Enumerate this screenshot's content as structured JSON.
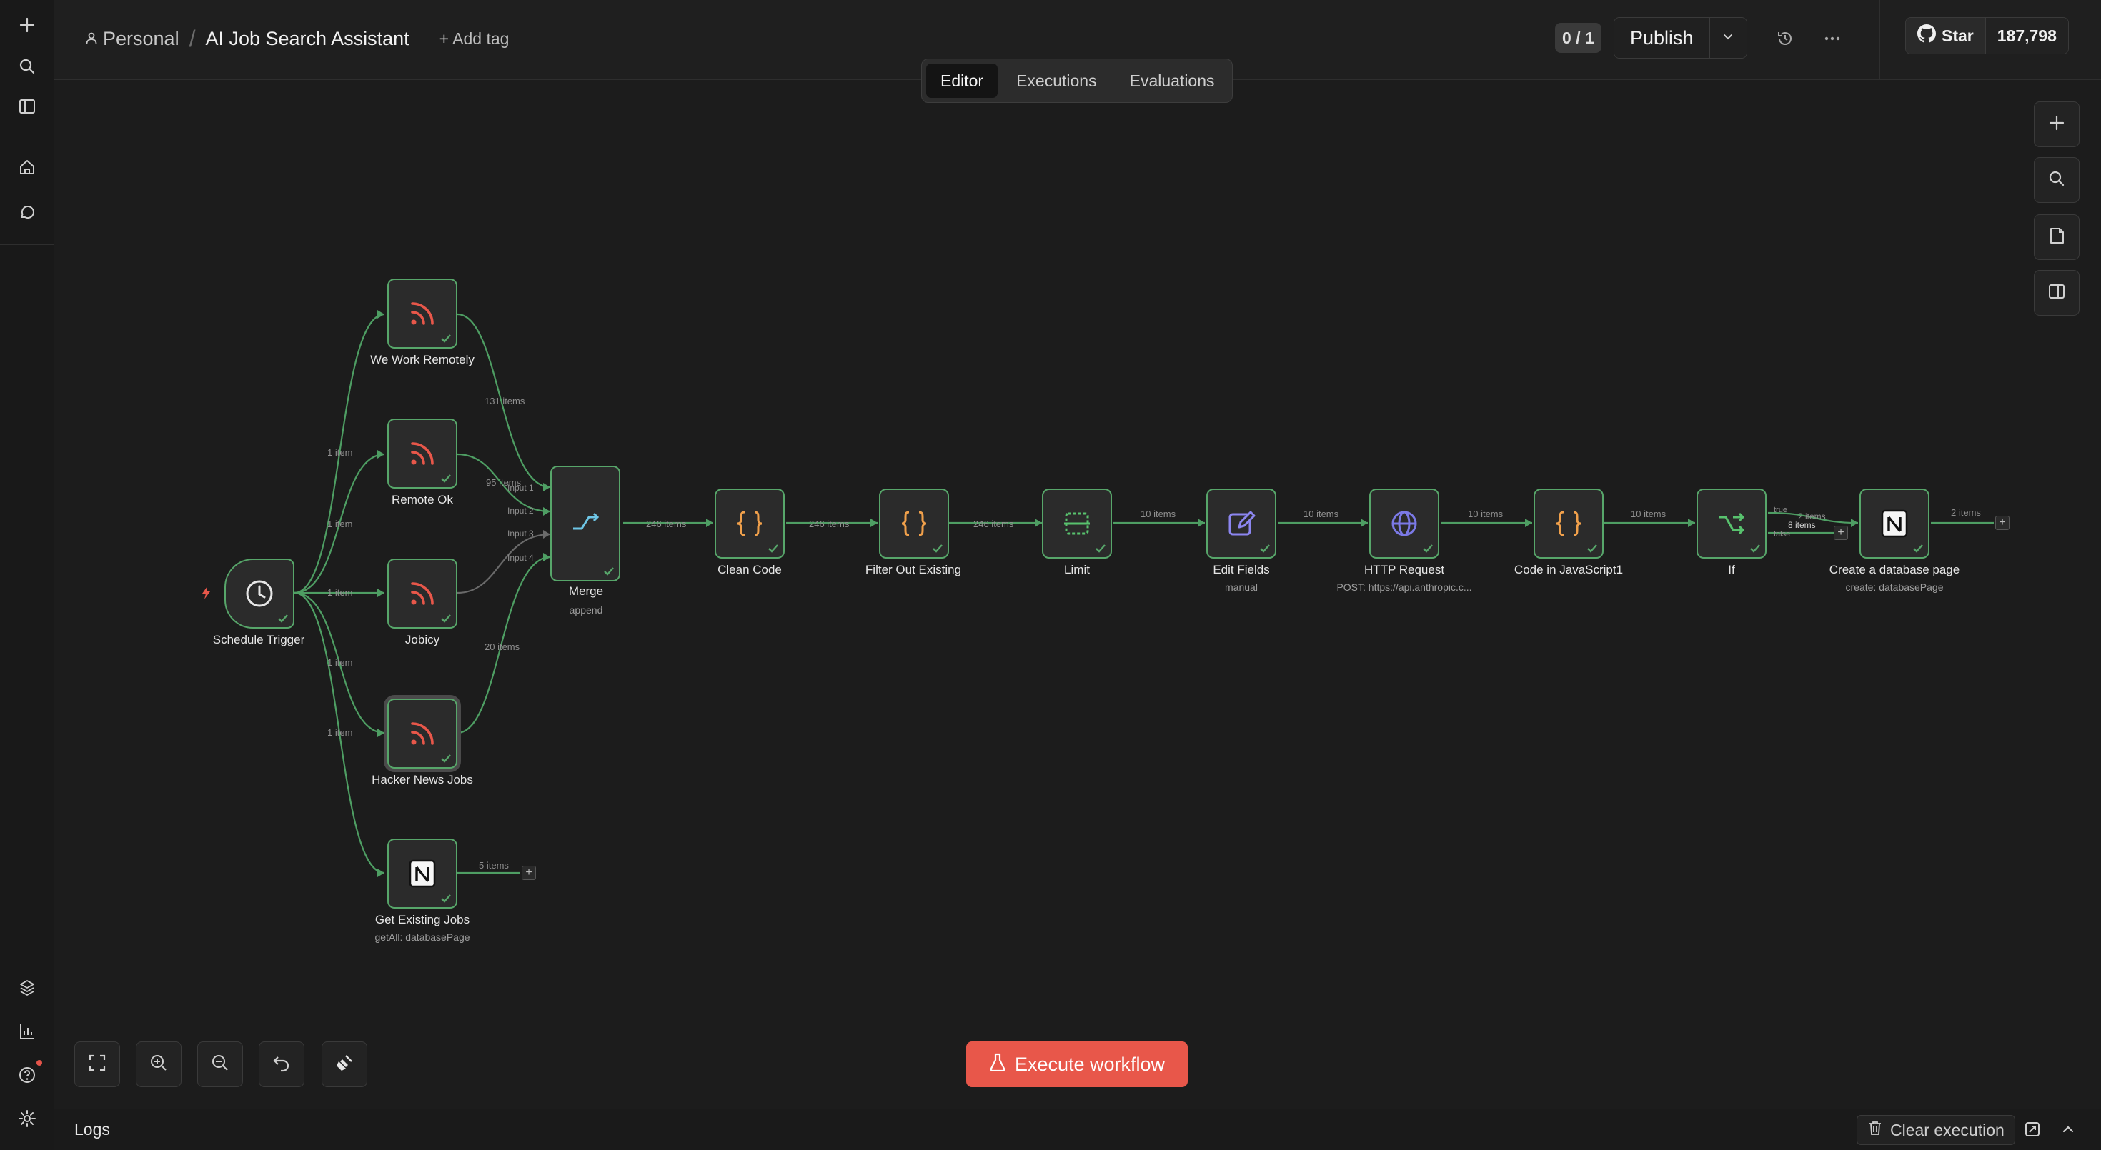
{
  "breadcrumb": {
    "owner": "Personal",
    "separator": "/",
    "title": "AI Job Search Assistant",
    "add_tag": "+ Add tag"
  },
  "header": {
    "counter": "0 / 1",
    "publish_label": "Publish"
  },
  "github": {
    "star_label": "Star",
    "star_count": "187,798"
  },
  "tabs": [
    {
      "label": "Editor",
      "active": true
    },
    {
      "label": "Executions"
    },
    {
      "label": "Evaluations"
    }
  ],
  "nodes": {
    "schedule": {
      "label": "Schedule Trigger"
    },
    "wwr": {
      "label": "We Work Remotely"
    },
    "remoteok": {
      "label": "Remote Ok"
    },
    "jobicy": {
      "label": "Jobicy"
    },
    "hn": {
      "label": "Hacker News Jobs"
    },
    "notion_get": {
      "label": "Get Existing Jobs",
      "sub": "getAll: databasePage"
    },
    "merge": {
      "label": "Merge",
      "sub": "append"
    },
    "clean": {
      "label": "Clean Code"
    },
    "filter": {
      "label": "Filter Out Existing"
    },
    "limit": {
      "label": "Limit"
    },
    "edit": {
      "label": "Edit Fields",
      "sub": "manual"
    },
    "http": {
      "label": "HTTP Request",
      "sub": "POST: https://api.anthropic.c..."
    },
    "code": {
      "label": "Code in JavaScript1"
    },
    "if": {
      "label": "If"
    },
    "notion_create": {
      "label": "Create a database page",
      "sub": "create: databasePage"
    }
  },
  "edges": {
    "e1": "1 item",
    "e2": "1 item",
    "e3": "1 item",
    "e4": "1 item",
    "e5": "1 item",
    "wwr_out": "131 items",
    "remoteok_out": "95 items",
    "hn_out": "20 items",
    "merge_in": [
      "Input 1",
      "Input 2",
      "Input 3",
      "Input 4"
    ],
    "get_out": "5 items",
    "merge_out": "246 items",
    "clean_out": "246 items",
    "filter_out": "246 items",
    "limit_out": "10 items",
    "edit_out": "10 items",
    "http_out": "10 items",
    "code_out": "10 items",
    "if_true": "true",
    "if_true_count": "2 items",
    "if_false": "false",
    "if_false_count": "8 items",
    "create_out": "2 items"
  },
  "actions": {
    "execute_label": "Execute workflow"
  },
  "logs": {
    "title": "Logs",
    "clear_label": "Clear execution"
  },
  "colors": {
    "accent": "#e8574a",
    "node_border": "#57a66a",
    "rss": "#e8574a",
    "code": "#f0a04b",
    "merge": "#6ec6e6",
    "edit": "#8c86f0",
    "http": "#7b79e6",
    "if": "#58c26e"
  }
}
